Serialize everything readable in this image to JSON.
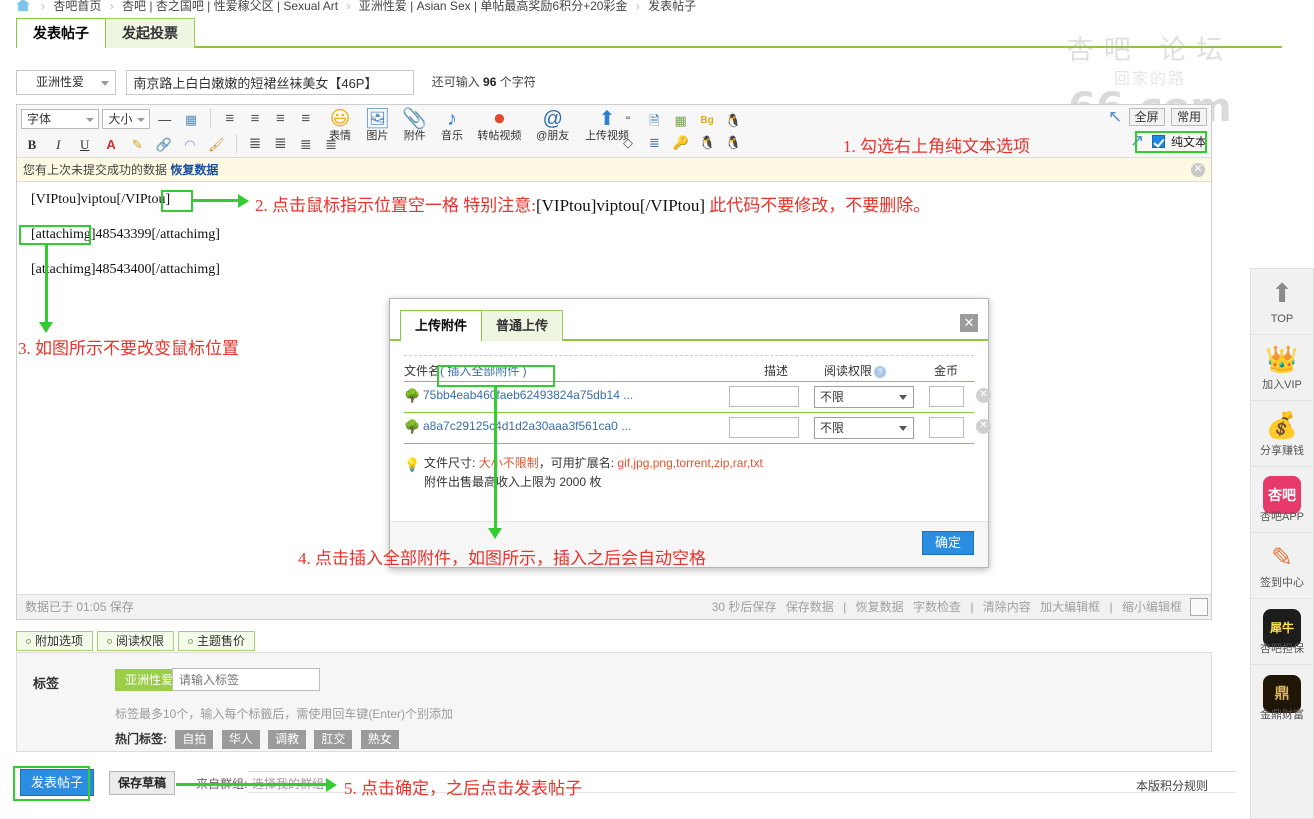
{
  "breadcrumb": {
    "home_icon": "home-icon",
    "items": [
      "杏吧首页",
      "杏吧 | 杏之国吧 | 性爱稼父区 | Sexual Art",
      "亚洲性爱 | Asian Sex | 单帖最高奖励6积分+20彩金",
      "发表帖子"
    ]
  },
  "tabs": [
    {
      "label": "发表帖子",
      "active": true
    },
    {
      "label": "发起投票",
      "active": false
    }
  ],
  "title_row": {
    "category": "亚洲性爱",
    "title_value": "南京路上白白嫩嫩的短裙丝袜美女【46P】",
    "chars_prefix": "还可输入",
    "chars_count": "96",
    "chars_suffix": "个字符"
  },
  "watermark": {
    "top": "杏吧 论坛",
    "mid": "回家的路",
    "bottom": "66.com"
  },
  "toolbar": {
    "font_label": "字体",
    "size_label": "大小",
    "row1_icons": [
      "minus-icon",
      "table-icon",
      "align-left-icon",
      "align-center-icon",
      "align-right-icon",
      "align-justify-icon"
    ],
    "row2_icons": [
      "bold-icon",
      "italic-icon",
      "underline-icon",
      "text-color-icon",
      "highlight-icon",
      "link-icon",
      "unlink-icon",
      "format-brush-icon",
      "indent-icon",
      "outdent-icon",
      "ordered-list-icon",
      "unordered-list-icon"
    ],
    "big_buttons": [
      {
        "icon": "smiley-icon",
        "label": "表情"
      },
      {
        "icon": "image-icon",
        "label": "图片"
      },
      {
        "icon": "paperclip-icon",
        "label": "附件"
      },
      {
        "icon": "music-note-icon",
        "label": "音乐"
      },
      {
        "icon": "video-repost-icon",
        "label": "转帖视频"
      },
      {
        "icon": "at-friend-icon",
        "label": "@朋友"
      },
      {
        "icon": "upload-video-icon",
        "label": "上传视频"
      }
    ],
    "extra_icons_row1": [
      "quote-icon",
      "word-doc-icon",
      "table-grid-icon",
      "bg-color-icon",
      "penguin-icon"
    ],
    "extra_icons_row2": [
      "code-icon",
      "align-list-icon",
      "key-icon",
      "penguin-hide-icon",
      "penguin2-icon"
    ],
    "fullscreen_label": "全屏",
    "common_label": "常用",
    "plaintext_label": "纯文本",
    "plaintext_checked": true,
    "undo_icon": "undo-arrow-icon",
    "redo_icon": "redo-arrow-icon"
  },
  "recover_bar": {
    "text": "您有上次未提交成功的数据",
    "link": "恢复数据",
    "close_icon": "close-icon"
  },
  "editor": {
    "lines": [
      "[VIPtou]viptou[/VIPtou]",
      "[attachimg]48543399[/attachimg]",
      "[attachimg]48543400[/attachimg]"
    ]
  },
  "status_bar": {
    "saved_text": "数据已于 01:05 保存",
    "right_items": [
      "30 秒后保存",
      "保存数据",
      "|",
      "恢复数据",
      "字数检查",
      "|",
      "清除内容",
      "加大编辑框",
      "|",
      "缩小编辑框"
    ],
    "icon": "image-placeholder-icon"
  },
  "option_tabs": [
    {
      "label": "附加选项"
    },
    {
      "label": "阅读权限"
    },
    {
      "label": "主题售价"
    }
  ],
  "tag_panel": {
    "label": "标签",
    "chip": "亚洲性爱",
    "input_placeholder": "请输入标签",
    "hint": "标签最多10个，输入每个标籤后，需使用回车键(Enter)个别添加",
    "hot_label": "热门标签:",
    "hot_tags": [
      "自拍",
      "华人",
      "调教",
      "肛交",
      "熟女"
    ]
  },
  "bottom_bar": {
    "post_button": "发表帖子",
    "draft_button": "保存草稿",
    "group_label": "来自群组:",
    "group_placeholder": "选择我的群组",
    "rules_link": "本版积分规则"
  },
  "dialog": {
    "tabs": [
      {
        "label": "上传附件",
        "active": true
      },
      {
        "label": "普通上传",
        "active": false
      }
    ],
    "close_icon": "close-icon",
    "headers": {
      "name": "文件名",
      "name_action": "( 插入全部附件 )",
      "desc": "描述",
      "perm": "阅读权限",
      "perm_help_icon": "help-icon",
      "coin": "金币"
    },
    "files": [
      {
        "icon": "attachment-thumb-icon",
        "name": "75bb4eab460faeb62493824a75db14 ...",
        "desc": "",
        "perm": "不限",
        "coin": "",
        "delete_icon": "delete-icon"
      },
      {
        "icon": "attachment-thumb-icon",
        "name": "a8a7c29125c4d1d2a30aaa3f561ca0 ...",
        "desc": "",
        "perm": "不限",
        "coin": "",
        "delete_icon": "delete-icon"
      }
    ],
    "tip_icon": "bulb-icon",
    "tip_line1_a": "文件尺寸:",
    "tip_line1_b": "大小不限制",
    "tip_line1_c": "，可用扩展名:",
    "tip_line1_d": "gif,jpg,png,torrent,zip,rar,txt",
    "tip_line2": "附件出售最高收入上限为 2000 枚",
    "ok_button": "确定"
  },
  "rail": [
    {
      "icon": "top-arrow-icon",
      "label": "TOP"
    },
    {
      "icon": "crown-icon",
      "label": "加入VIP"
    },
    {
      "icon": "money-bag-icon",
      "label": "分享赚钱"
    },
    {
      "icon": "xingba-app-icon",
      "label": "杏吧APP",
      "badge_text": "杏吧",
      "badge_color": "#e8396b"
    },
    {
      "icon": "pencil-icon",
      "label": "签到中心"
    },
    {
      "icon": "rhino-icon",
      "label": "杏吧担保",
      "badge_text": "犀牛",
      "badge_color": "#1c1c1c"
    },
    {
      "icon": "treasure-icon",
      "label": "金鼎财富",
      "badge_text": "鼎",
      "badge_color": "#201608"
    }
  ],
  "annotations": [
    {
      "id": 1,
      "text": "1. 勾选右上角纯文本选项"
    },
    {
      "id": 2,
      "text": "2. 点击鼠标指示位置空一格 特别注意:",
      "code": "[VIPtou]viptou[/VIPtou]",
      "text2": "此代码不要修改，不要删除。"
    },
    {
      "id": 3,
      "text": "3. 如图所示不要改变鼠标位置"
    },
    {
      "id": 4,
      "text": "4. 点击插入全部附件，如图所示，插入之后会自动空格"
    },
    {
      "id": 5,
      "text": "5. 点击确定，之后点击发表帖子"
    }
  ]
}
